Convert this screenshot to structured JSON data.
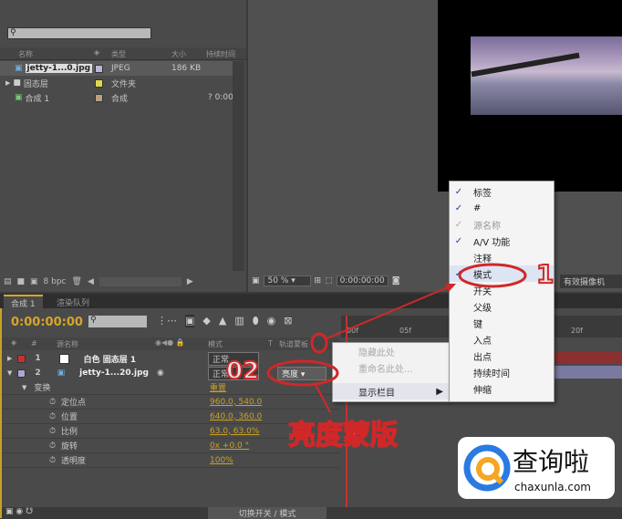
{
  "project": {
    "search_placeholder": "",
    "columns": [
      "名称",
      "类型",
      "大小",
      "持续时间"
    ],
    "items": [
      {
        "name": "jetty-1...0.jpg",
        "type": "JPEG",
        "size": "186 KB",
        "duration": "",
        "color": "#b8b8d8"
      },
      {
        "name": "固态层",
        "type": "文件夹",
        "size": "",
        "duration": "",
        "color": "#e0d84a"
      },
      {
        "name": "合成 1",
        "type": "合成",
        "size": "",
        "duration": "? 0:00",
        "color": "#b8a080"
      }
    ],
    "bpc": "8 bpc"
  },
  "viewer": {
    "zoom": "50 %",
    "timecode": "0:00:00:00",
    "camera": "有效摄像机"
  },
  "tabs": [
    "合成 1",
    "渲染队列"
  ],
  "timeline": {
    "timecode": "0:00:00:00",
    "columns": {
      "source": "源名称",
      "mode": "模式",
      "t": "T",
      "track_matte": "轨道蒙板"
    },
    "ruler": [
      "00f",
      "05f",
      "20f"
    ],
    "layers": [
      {
        "num": "1",
        "name": "白色 固态层 1",
        "mode": "正常",
        "color": "#c83030"
      },
      {
        "num": "2",
        "name": "jetty-1...20.jpg",
        "mode": "正常",
        "matte": "亮度",
        "color": "#a8a8d0"
      }
    ],
    "transform": {
      "label": "变换",
      "reset": "重置",
      "props": [
        {
          "name": "定位点",
          "value": "960.0, 540.0"
        },
        {
          "name": "位置",
          "value": "640.0, 360.0"
        },
        {
          "name": "比例",
          "value": "63.0, 63.0%"
        },
        {
          "name": "旋转",
          "value": "0x +0.0 °"
        },
        {
          "name": "透明度",
          "value": "100%"
        }
      ]
    },
    "bottom": "切换开关 / 模式"
  },
  "context_menu": [
    {
      "label": "隐藏此处",
      "disabled": true
    },
    {
      "label": "重命名此处...",
      "disabled": true
    },
    {
      "label": "显示栏目",
      "disabled": false
    }
  ],
  "submenu": [
    {
      "label": "标签",
      "checked": true
    },
    {
      "label": "#",
      "checked": true
    },
    {
      "label": "源名称",
      "checked": true,
      "disabled": true
    },
    {
      "label": "A/V 功能",
      "checked": true
    },
    {
      "label": "注释",
      "checked": false
    },
    {
      "label": "模式",
      "checked": true
    },
    {
      "label": "开关",
      "checked": false
    },
    {
      "label": "父级",
      "checked": false
    },
    {
      "label": "键",
      "checked": false
    },
    {
      "label": "入点",
      "checked": false
    },
    {
      "label": "出点",
      "checked": false
    },
    {
      "label": "持续时间",
      "checked": false
    },
    {
      "label": "伸缩",
      "checked": false
    }
  ],
  "annotations": {
    "step1": "1",
    "step2": "02",
    "caption": "亮度蒙版"
  },
  "watermark": {
    "brand": "查询啦",
    "domain": "chaxunla.com"
  },
  "colors": {
    "accent": "#d4a62a",
    "annotation": "#d02828"
  }
}
